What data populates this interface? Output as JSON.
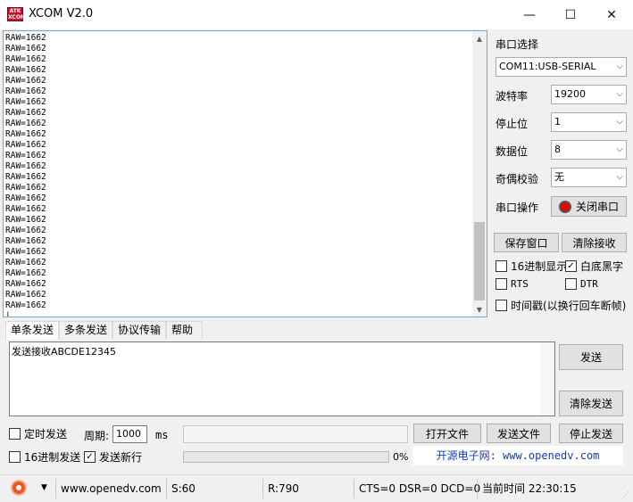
{
  "window": {
    "title": "XCOM V2.0",
    "logo_text": "ATK XCOM",
    "minimize": "—",
    "maximize": "☐",
    "close": "✕"
  },
  "receive": {
    "text": "RAW=1662\nRAW=1662\nRAW=1662\nRAW=1662\nRAW=1662\nRAW=1662\nRAW=1662\nRAW=1662\nRAW=1662\nRAW=1662\nRAW=1662\nRAW=1662\nRAW=1662\nRAW=1662\nRAW=1662\nRAW=1662\nRAW=1662\nRAW=1662\nRAW=1662\nRAW=1662\nRAW=1662\nRAW=1662\nRAW=1662\nRAW=1662\nRAW=1662\nRAW=1662\n|",
    "scroll_up": "▲",
    "scroll_down": "▼"
  },
  "settings": {
    "port_label": "串口选择",
    "port_value": "COM11:USB-SERIAL",
    "baud_label": "波特率",
    "baud_value": "19200",
    "stop_label": "停止位",
    "stop_value": "1",
    "data_label": "数据位",
    "data_value": "8",
    "parity_label": "奇偶校验",
    "parity_value": "无",
    "operation_label": "串口操作",
    "close_port_button": "关闭串口",
    "chevron": "⌵"
  },
  "actions": {
    "save_window": "保存窗口",
    "clear_receive": "清除接收",
    "hex_display": "16进制显示",
    "white_bg_black_text": "白底黑字",
    "white_bg_checked": "✓",
    "rts": "RTS",
    "dtr": "DTR",
    "timestamp": "时间戳(以换行回车断帧)"
  },
  "tabs": [
    "单条发送",
    "多条发送",
    "协议传输",
    "帮助"
  ],
  "send": {
    "text": "发送接收ABCDE12345",
    "send_button": "发送",
    "clear_send_button": "清除发送",
    "timed_send": "定时发送",
    "period_label": "周期:",
    "period_value": "1000",
    "period_unit": "ms",
    "file_path": "",
    "open_file_button": "打开文件",
    "send_file_button": "发送文件",
    "stop_send_button": "停止发送",
    "hex_send": "16进制发送",
    "send_newline": "发送新行",
    "send_newline_checked": "✓",
    "progress_percent": 0,
    "progress_label": "0%",
    "website": "开源电子网: www.openedv.com"
  },
  "status": {
    "dropdown": "▼",
    "website": "www.openedv.com",
    "sent": "S:60",
    "received": "R:790",
    "lines": "CTS=0 DSR=0 DCD=0",
    "time": "当前时间 22:30:15",
    "grip": "⋰"
  },
  "colors": {
    "accent_border": "#7aa7c7",
    "record_red": "#e85a1c",
    "website_blue": "#1a3ab5"
  }
}
